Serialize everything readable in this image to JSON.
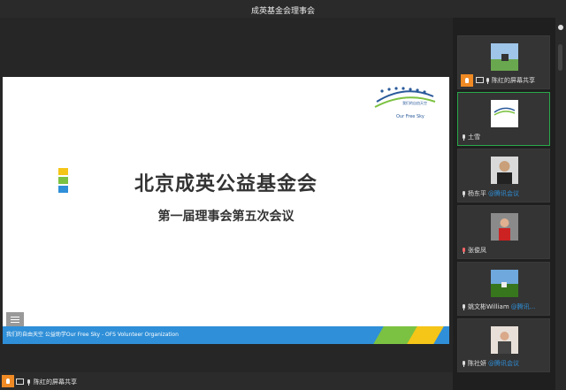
{
  "window": {
    "title": "成英基金会理事会"
  },
  "slide": {
    "title": "北京成英公益基金会",
    "subtitle": "第一届理事会第五次会议",
    "logo_text": "我们的自由天空",
    "footer": "我们的自由天空  公益助学Our Free Sky - OFS Volunteer Organization",
    "bar_colors": [
      "#f5c518",
      "#7cc242",
      "#2f8fd8"
    ]
  },
  "participants": [
    {
      "name": "陈红的屏幕共享",
      "tag": "",
      "sharing": true,
      "active": false,
      "thumb": "grass-horse"
    },
    {
      "name": "土雪",
      "tag": "",
      "sharing": false,
      "active": true,
      "thumb": "logo"
    },
    {
      "name": "杨东平",
      "tag": "@腾讯会议",
      "sharing": false,
      "active": false,
      "thumb": "man"
    },
    {
      "name": "张俊凤",
      "tag": "",
      "sharing": false,
      "active": false,
      "thumb": "woman-red",
      "mic_muted": true
    },
    {
      "name": "姚文彬William",
      "tag": "@腾讯...",
      "sharing": false,
      "active": false,
      "thumb": "landscape"
    },
    {
      "name": "陈社妍",
      "tag": "@腾讯会议",
      "sharing": false,
      "active": false,
      "thumb": "woman"
    }
  ],
  "bottom": {
    "label": "陈红的屏幕共享"
  }
}
